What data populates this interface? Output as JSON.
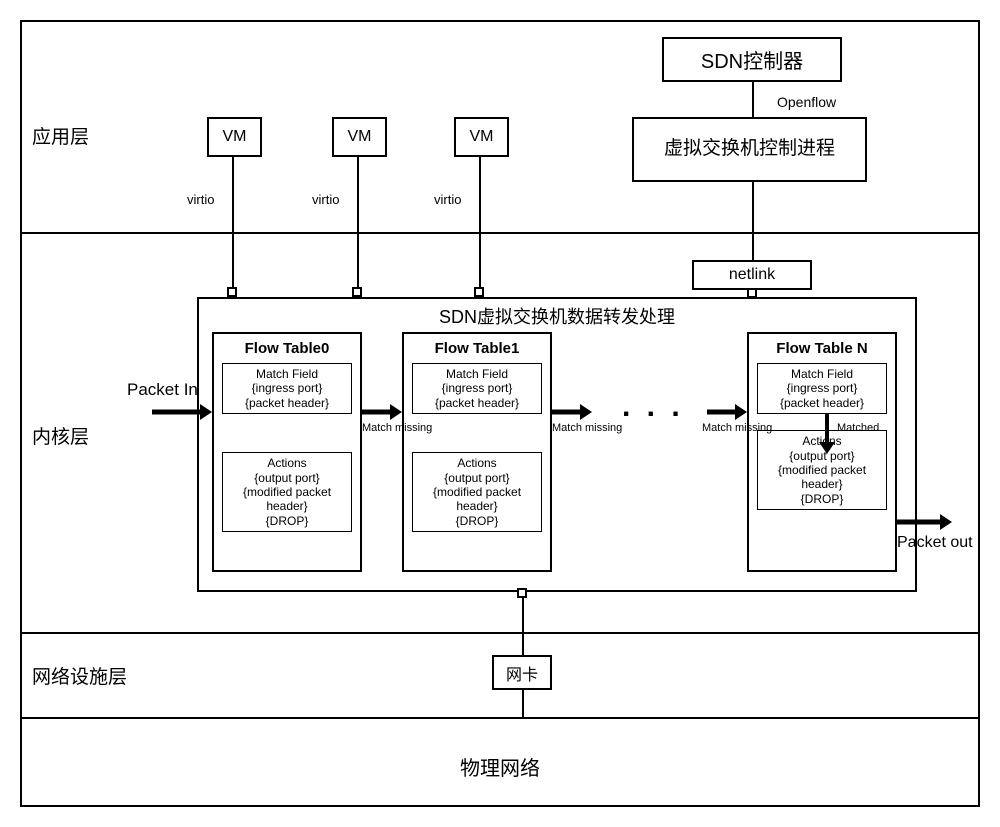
{
  "layers": {
    "app": "应用层",
    "kernel": "内核层",
    "network_facility": "网络设施层",
    "physical": "物理网络"
  },
  "app": {
    "sdn_controller": "SDN控制器",
    "openflow": "Openflow",
    "vswitch_control_process": "虚拟交换机控制进程",
    "vm": "VM",
    "virtio": "virtio"
  },
  "kernel": {
    "netlink": "netlink",
    "switch_title": "SDN虚拟交换机数据转发处理",
    "packet_in": "Packet In",
    "packet_out": "Packet out",
    "match_missing": "Match missing",
    "matched": "Matched",
    "dots": ". . .",
    "flow_tables": [
      {
        "title": "Flow Table0"
      },
      {
        "title": "Flow Table1"
      },
      {
        "title": "Flow Table N"
      }
    ],
    "match_field": {
      "h": "Match Field",
      "l1": "{ingress port}",
      "l2": "{packet header}"
    },
    "actions": {
      "h": "Actions",
      "l1": "{output port}",
      "l2": "{modified packet header}",
      "l3": "{DROP}"
    }
  },
  "nic": "网卡"
}
